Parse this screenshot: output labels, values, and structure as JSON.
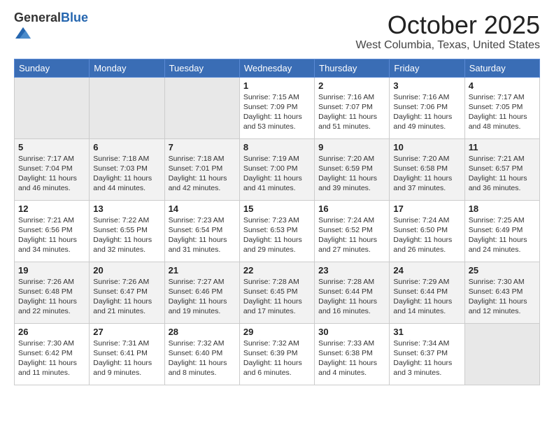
{
  "header": {
    "logo_general": "General",
    "logo_blue": "Blue",
    "month": "October 2025",
    "location": "West Columbia, Texas, United States"
  },
  "days_of_week": [
    "Sunday",
    "Monday",
    "Tuesday",
    "Wednesday",
    "Thursday",
    "Friday",
    "Saturday"
  ],
  "weeks": [
    [
      {
        "day": "",
        "info": ""
      },
      {
        "day": "",
        "info": ""
      },
      {
        "day": "",
        "info": ""
      },
      {
        "day": "1",
        "info": "Sunrise: 7:15 AM\nSunset: 7:09 PM\nDaylight: 11 hours\nand 53 minutes."
      },
      {
        "day": "2",
        "info": "Sunrise: 7:16 AM\nSunset: 7:07 PM\nDaylight: 11 hours\nand 51 minutes."
      },
      {
        "day": "3",
        "info": "Sunrise: 7:16 AM\nSunset: 7:06 PM\nDaylight: 11 hours\nand 49 minutes."
      },
      {
        "day": "4",
        "info": "Sunrise: 7:17 AM\nSunset: 7:05 PM\nDaylight: 11 hours\nand 48 minutes."
      }
    ],
    [
      {
        "day": "5",
        "info": "Sunrise: 7:17 AM\nSunset: 7:04 PM\nDaylight: 11 hours\nand 46 minutes."
      },
      {
        "day": "6",
        "info": "Sunrise: 7:18 AM\nSunset: 7:03 PM\nDaylight: 11 hours\nand 44 minutes."
      },
      {
        "day": "7",
        "info": "Sunrise: 7:18 AM\nSunset: 7:01 PM\nDaylight: 11 hours\nand 42 minutes."
      },
      {
        "day": "8",
        "info": "Sunrise: 7:19 AM\nSunset: 7:00 PM\nDaylight: 11 hours\nand 41 minutes."
      },
      {
        "day": "9",
        "info": "Sunrise: 7:20 AM\nSunset: 6:59 PM\nDaylight: 11 hours\nand 39 minutes."
      },
      {
        "day": "10",
        "info": "Sunrise: 7:20 AM\nSunset: 6:58 PM\nDaylight: 11 hours\nand 37 minutes."
      },
      {
        "day": "11",
        "info": "Sunrise: 7:21 AM\nSunset: 6:57 PM\nDaylight: 11 hours\nand 36 minutes."
      }
    ],
    [
      {
        "day": "12",
        "info": "Sunrise: 7:21 AM\nSunset: 6:56 PM\nDaylight: 11 hours\nand 34 minutes."
      },
      {
        "day": "13",
        "info": "Sunrise: 7:22 AM\nSunset: 6:55 PM\nDaylight: 11 hours\nand 32 minutes."
      },
      {
        "day": "14",
        "info": "Sunrise: 7:23 AM\nSunset: 6:54 PM\nDaylight: 11 hours\nand 31 minutes."
      },
      {
        "day": "15",
        "info": "Sunrise: 7:23 AM\nSunset: 6:53 PM\nDaylight: 11 hours\nand 29 minutes."
      },
      {
        "day": "16",
        "info": "Sunrise: 7:24 AM\nSunset: 6:52 PM\nDaylight: 11 hours\nand 27 minutes."
      },
      {
        "day": "17",
        "info": "Sunrise: 7:24 AM\nSunset: 6:50 PM\nDaylight: 11 hours\nand 26 minutes."
      },
      {
        "day": "18",
        "info": "Sunrise: 7:25 AM\nSunset: 6:49 PM\nDaylight: 11 hours\nand 24 minutes."
      }
    ],
    [
      {
        "day": "19",
        "info": "Sunrise: 7:26 AM\nSunset: 6:48 PM\nDaylight: 11 hours\nand 22 minutes."
      },
      {
        "day": "20",
        "info": "Sunrise: 7:26 AM\nSunset: 6:47 PM\nDaylight: 11 hours\nand 21 minutes."
      },
      {
        "day": "21",
        "info": "Sunrise: 7:27 AM\nSunset: 6:46 PM\nDaylight: 11 hours\nand 19 minutes."
      },
      {
        "day": "22",
        "info": "Sunrise: 7:28 AM\nSunset: 6:45 PM\nDaylight: 11 hours\nand 17 minutes."
      },
      {
        "day": "23",
        "info": "Sunrise: 7:28 AM\nSunset: 6:44 PM\nDaylight: 11 hours\nand 16 minutes."
      },
      {
        "day": "24",
        "info": "Sunrise: 7:29 AM\nSunset: 6:44 PM\nDaylight: 11 hours\nand 14 minutes."
      },
      {
        "day": "25",
        "info": "Sunrise: 7:30 AM\nSunset: 6:43 PM\nDaylight: 11 hours\nand 12 minutes."
      }
    ],
    [
      {
        "day": "26",
        "info": "Sunrise: 7:30 AM\nSunset: 6:42 PM\nDaylight: 11 hours\nand 11 minutes."
      },
      {
        "day": "27",
        "info": "Sunrise: 7:31 AM\nSunset: 6:41 PM\nDaylight: 11 hours\nand 9 minutes."
      },
      {
        "day": "28",
        "info": "Sunrise: 7:32 AM\nSunset: 6:40 PM\nDaylight: 11 hours\nand 8 minutes."
      },
      {
        "day": "29",
        "info": "Sunrise: 7:32 AM\nSunset: 6:39 PM\nDaylight: 11 hours\nand 6 minutes."
      },
      {
        "day": "30",
        "info": "Sunrise: 7:33 AM\nSunset: 6:38 PM\nDaylight: 11 hours\nand 4 minutes."
      },
      {
        "day": "31",
        "info": "Sunrise: 7:34 AM\nSunset: 6:37 PM\nDaylight: 11 hours\nand 3 minutes."
      },
      {
        "day": "",
        "info": ""
      }
    ]
  ]
}
